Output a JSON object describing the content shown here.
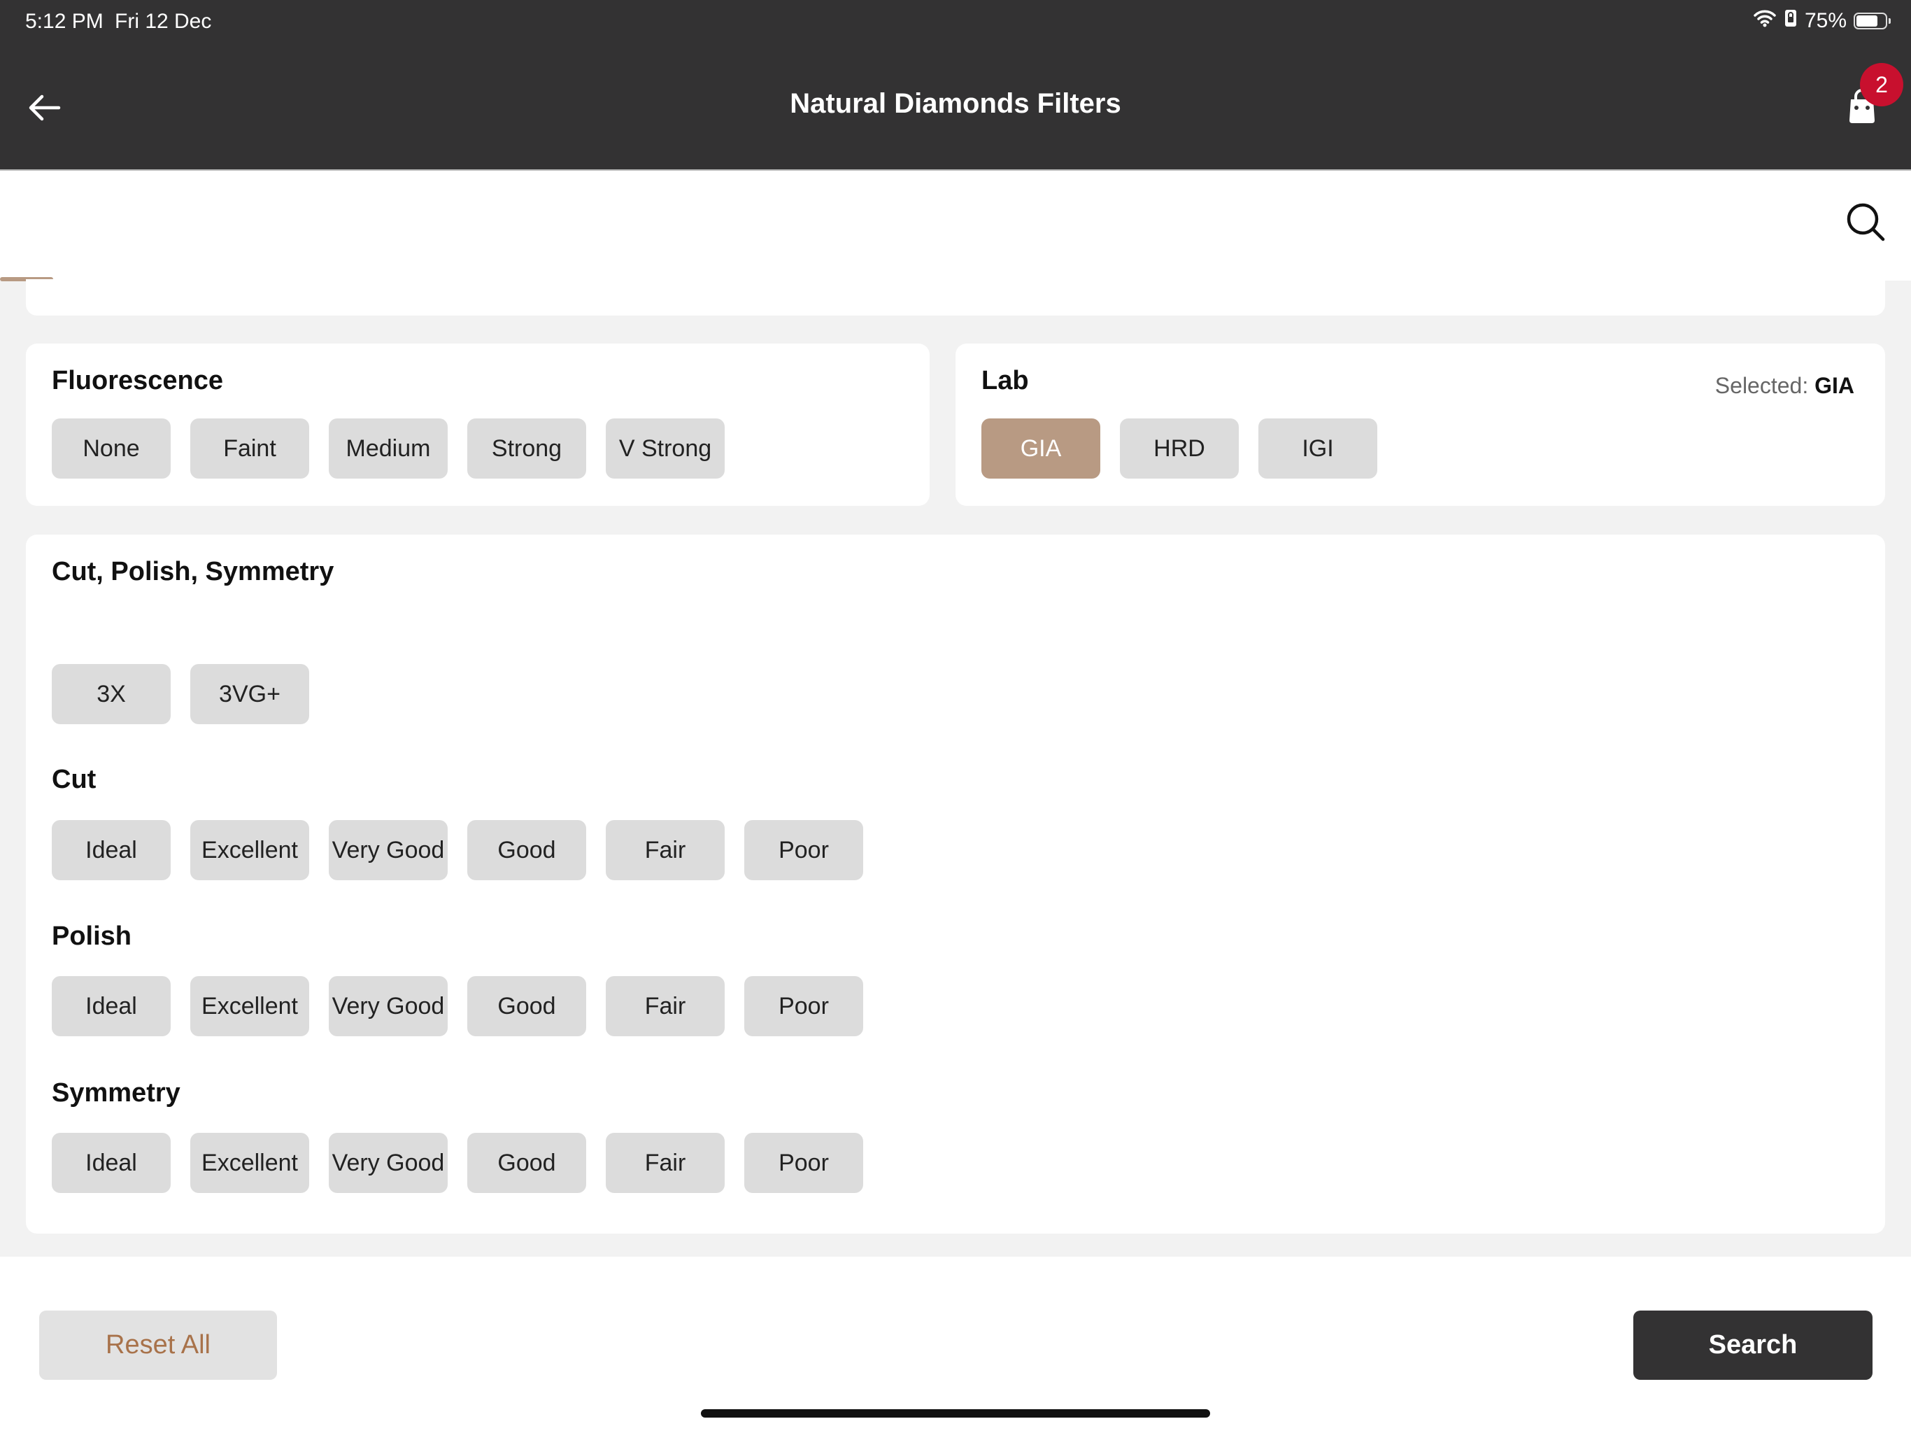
{
  "status_bar": {
    "time": "5:12 PM",
    "date": "Fri 12 Dec",
    "battery": "75%",
    "battery_level": 0.75,
    "wifi_icon": "wifi-icon",
    "lock_icon": "orientation-lock-icon"
  },
  "header": {
    "title": "Natural Diamonds Filters",
    "back_icon": "arrow-left-icon",
    "cart_icon": "shopping-bag-icon",
    "cart_count": "2"
  },
  "search": {
    "icon": "search-icon"
  },
  "fluorescence": {
    "title": "Fluorescence",
    "options": [
      "None",
      "Faint",
      "Medium",
      "Strong",
      "V Strong"
    ]
  },
  "lab": {
    "title": "Lab",
    "selected_label": "Selected: ",
    "selected_value": "GIA",
    "options": [
      "GIA",
      "HRD",
      "IGI"
    ]
  },
  "cut_polish_symmetry": {
    "title": "Cut, Polish, Symmetry",
    "presets": [
      "3X",
      "3VG+"
    ],
    "cut": {
      "title": "Cut",
      "options": [
        "Ideal",
        "Excellent",
        "Very Good",
        "Good",
        "Fair",
        "Poor"
      ]
    },
    "polish": {
      "title": "Polish",
      "options": [
        "Ideal",
        "Excellent",
        "Very Good",
        "Good",
        "Fair",
        "Poor"
      ]
    },
    "symmetry": {
      "title": "Symmetry",
      "options": [
        "Ideal",
        "Excellent",
        "Very Good",
        "Good",
        "Fair",
        "Poor"
      ]
    }
  },
  "footer": {
    "reset_label": "Reset All",
    "search_label": "Search"
  },
  "colors": {
    "header_bg": "#333233",
    "accent": "#b89a83",
    "chip_bg": "#dcdcdc",
    "badge": "#c8102e",
    "reset_text": "#a8724a"
  }
}
